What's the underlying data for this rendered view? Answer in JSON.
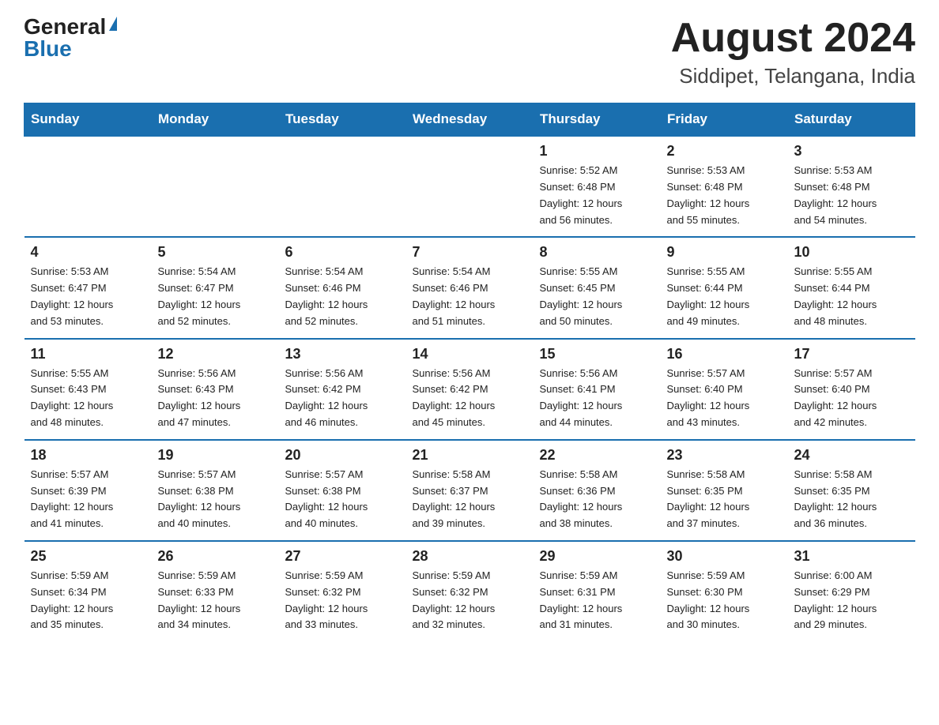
{
  "header": {
    "logo_general": "General",
    "logo_blue": "Blue",
    "title": "August 2024",
    "subtitle": "Siddipet, Telangana, India"
  },
  "weekdays": [
    "Sunday",
    "Monday",
    "Tuesday",
    "Wednesday",
    "Thursday",
    "Friday",
    "Saturday"
  ],
  "weeks": [
    [
      {
        "day": "",
        "info": ""
      },
      {
        "day": "",
        "info": ""
      },
      {
        "day": "",
        "info": ""
      },
      {
        "day": "",
        "info": ""
      },
      {
        "day": "1",
        "info": "Sunrise: 5:52 AM\nSunset: 6:48 PM\nDaylight: 12 hours\nand 56 minutes."
      },
      {
        "day": "2",
        "info": "Sunrise: 5:53 AM\nSunset: 6:48 PM\nDaylight: 12 hours\nand 55 minutes."
      },
      {
        "day": "3",
        "info": "Sunrise: 5:53 AM\nSunset: 6:48 PM\nDaylight: 12 hours\nand 54 minutes."
      }
    ],
    [
      {
        "day": "4",
        "info": "Sunrise: 5:53 AM\nSunset: 6:47 PM\nDaylight: 12 hours\nand 53 minutes."
      },
      {
        "day": "5",
        "info": "Sunrise: 5:54 AM\nSunset: 6:47 PM\nDaylight: 12 hours\nand 52 minutes."
      },
      {
        "day": "6",
        "info": "Sunrise: 5:54 AM\nSunset: 6:46 PM\nDaylight: 12 hours\nand 52 minutes."
      },
      {
        "day": "7",
        "info": "Sunrise: 5:54 AM\nSunset: 6:46 PM\nDaylight: 12 hours\nand 51 minutes."
      },
      {
        "day": "8",
        "info": "Sunrise: 5:55 AM\nSunset: 6:45 PM\nDaylight: 12 hours\nand 50 minutes."
      },
      {
        "day": "9",
        "info": "Sunrise: 5:55 AM\nSunset: 6:44 PM\nDaylight: 12 hours\nand 49 minutes."
      },
      {
        "day": "10",
        "info": "Sunrise: 5:55 AM\nSunset: 6:44 PM\nDaylight: 12 hours\nand 48 minutes."
      }
    ],
    [
      {
        "day": "11",
        "info": "Sunrise: 5:55 AM\nSunset: 6:43 PM\nDaylight: 12 hours\nand 48 minutes."
      },
      {
        "day": "12",
        "info": "Sunrise: 5:56 AM\nSunset: 6:43 PM\nDaylight: 12 hours\nand 47 minutes."
      },
      {
        "day": "13",
        "info": "Sunrise: 5:56 AM\nSunset: 6:42 PM\nDaylight: 12 hours\nand 46 minutes."
      },
      {
        "day": "14",
        "info": "Sunrise: 5:56 AM\nSunset: 6:42 PM\nDaylight: 12 hours\nand 45 minutes."
      },
      {
        "day": "15",
        "info": "Sunrise: 5:56 AM\nSunset: 6:41 PM\nDaylight: 12 hours\nand 44 minutes."
      },
      {
        "day": "16",
        "info": "Sunrise: 5:57 AM\nSunset: 6:40 PM\nDaylight: 12 hours\nand 43 minutes."
      },
      {
        "day": "17",
        "info": "Sunrise: 5:57 AM\nSunset: 6:40 PM\nDaylight: 12 hours\nand 42 minutes."
      }
    ],
    [
      {
        "day": "18",
        "info": "Sunrise: 5:57 AM\nSunset: 6:39 PM\nDaylight: 12 hours\nand 41 minutes."
      },
      {
        "day": "19",
        "info": "Sunrise: 5:57 AM\nSunset: 6:38 PM\nDaylight: 12 hours\nand 40 minutes."
      },
      {
        "day": "20",
        "info": "Sunrise: 5:57 AM\nSunset: 6:38 PM\nDaylight: 12 hours\nand 40 minutes."
      },
      {
        "day": "21",
        "info": "Sunrise: 5:58 AM\nSunset: 6:37 PM\nDaylight: 12 hours\nand 39 minutes."
      },
      {
        "day": "22",
        "info": "Sunrise: 5:58 AM\nSunset: 6:36 PM\nDaylight: 12 hours\nand 38 minutes."
      },
      {
        "day": "23",
        "info": "Sunrise: 5:58 AM\nSunset: 6:35 PM\nDaylight: 12 hours\nand 37 minutes."
      },
      {
        "day": "24",
        "info": "Sunrise: 5:58 AM\nSunset: 6:35 PM\nDaylight: 12 hours\nand 36 minutes."
      }
    ],
    [
      {
        "day": "25",
        "info": "Sunrise: 5:59 AM\nSunset: 6:34 PM\nDaylight: 12 hours\nand 35 minutes."
      },
      {
        "day": "26",
        "info": "Sunrise: 5:59 AM\nSunset: 6:33 PM\nDaylight: 12 hours\nand 34 minutes."
      },
      {
        "day": "27",
        "info": "Sunrise: 5:59 AM\nSunset: 6:32 PM\nDaylight: 12 hours\nand 33 minutes."
      },
      {
        "day": "28",
        "info": "Sunrise: 5:59 AM\nSunset: 6:32 PM\nDaylight: 12 hours\nand 32 minutes."
      },
      {
        "day": "29",
        "info": "Sunrise: 5:59 AM\nSunset: 6:31 PM\nDaylight: 12 hours\nand 31 minutes."
      },
      {
        "day": "30",
        "info": "Sunrise: 5:59 AM\nSunset: 6:30 PM\nDaylight: 12 hours\nand 30 minutes."
      },
      {
        "day": "31",
        "info": "Sunrise: 6:00 AM\nSunset: 6:29 PM\nDaylight: 12 hours\nand 29 minutes."
      }
    ]
  ]
}
